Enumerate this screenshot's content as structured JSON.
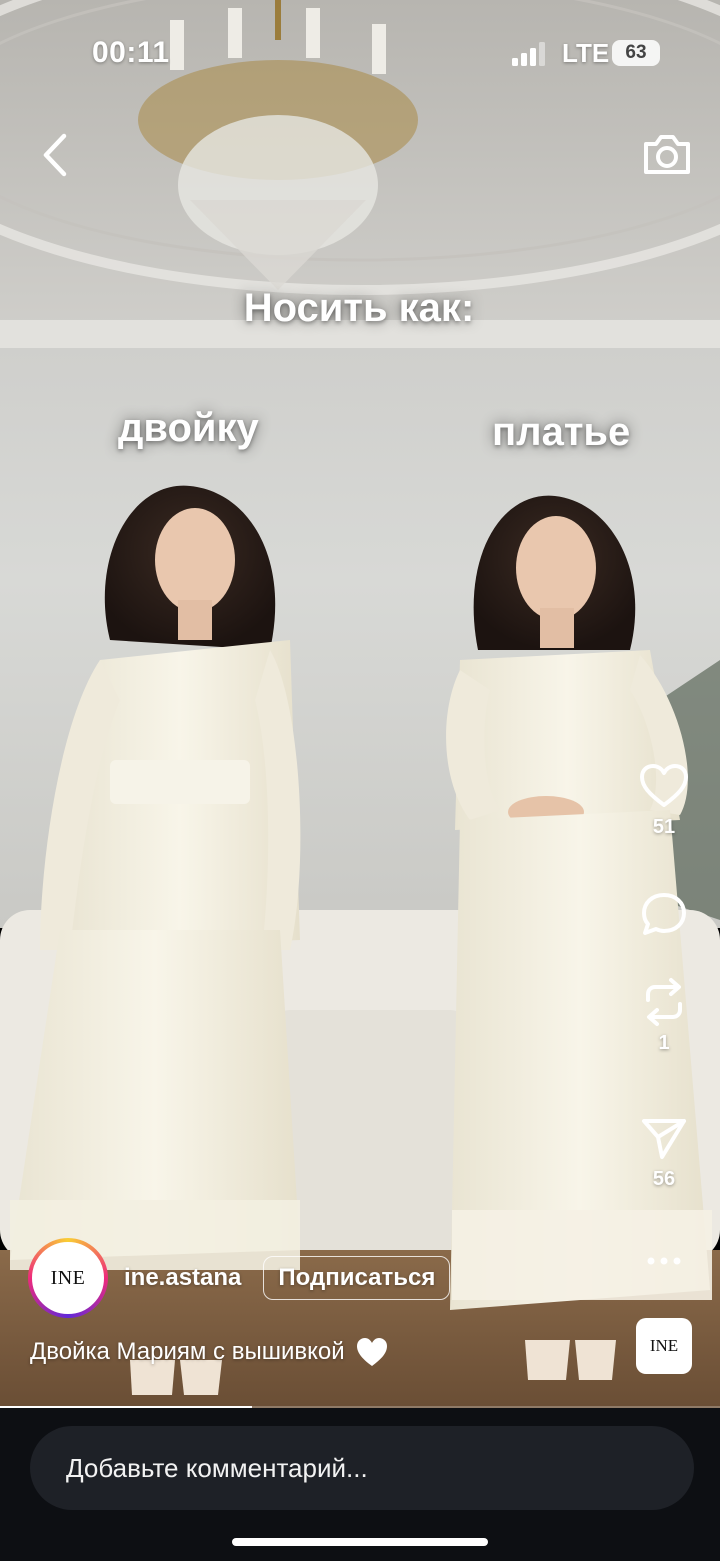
{
  "status_bar": {
    "time": "00:11",
    "network": "LTE",
    "battery": "63"
  },
  "overlay": {
    "title": "Носить как:",
    "left_label": "двойку",
    "right_label": "платье"
  },
  "actions": {
    "likes": "51",
    "comments": "",
    "reposts": "1",
    "shares": "56"
  },
  "author": {
    "avatar_text": "INE",
    "username": "ine.astana",
    "follow_label": "Подписаться"
  },
  "caption": {
    "text": "Двойка Мариям с вышивкой"
  },
  "audio_thumb": {
    "text": "INE"
  },
  "progress": {
    "fraction": 0.35
  },
  "comment_input": {
    "placeholder": "Добавьте комментарий..."
  },
  "icons": {
    "back": "chevron-left-icon",
    "camera": "camera-icon",
    "like": "heart-outline-icon",
    "comment": "speech-bubble-icon",
    "repost": "repost-arrows-icon",
    "share": "paper-plane-icon",
    "more": "ellipsis-icon",
    "caption_emoji": "white-heart-icon"
  },
  "colors": {
    "bottom_bg": "#0d0f13",
    "input_bg": "#1e2127",
    "dress": "#f4f0e2",
    "wall": "#dcdcd8"
  }
}
